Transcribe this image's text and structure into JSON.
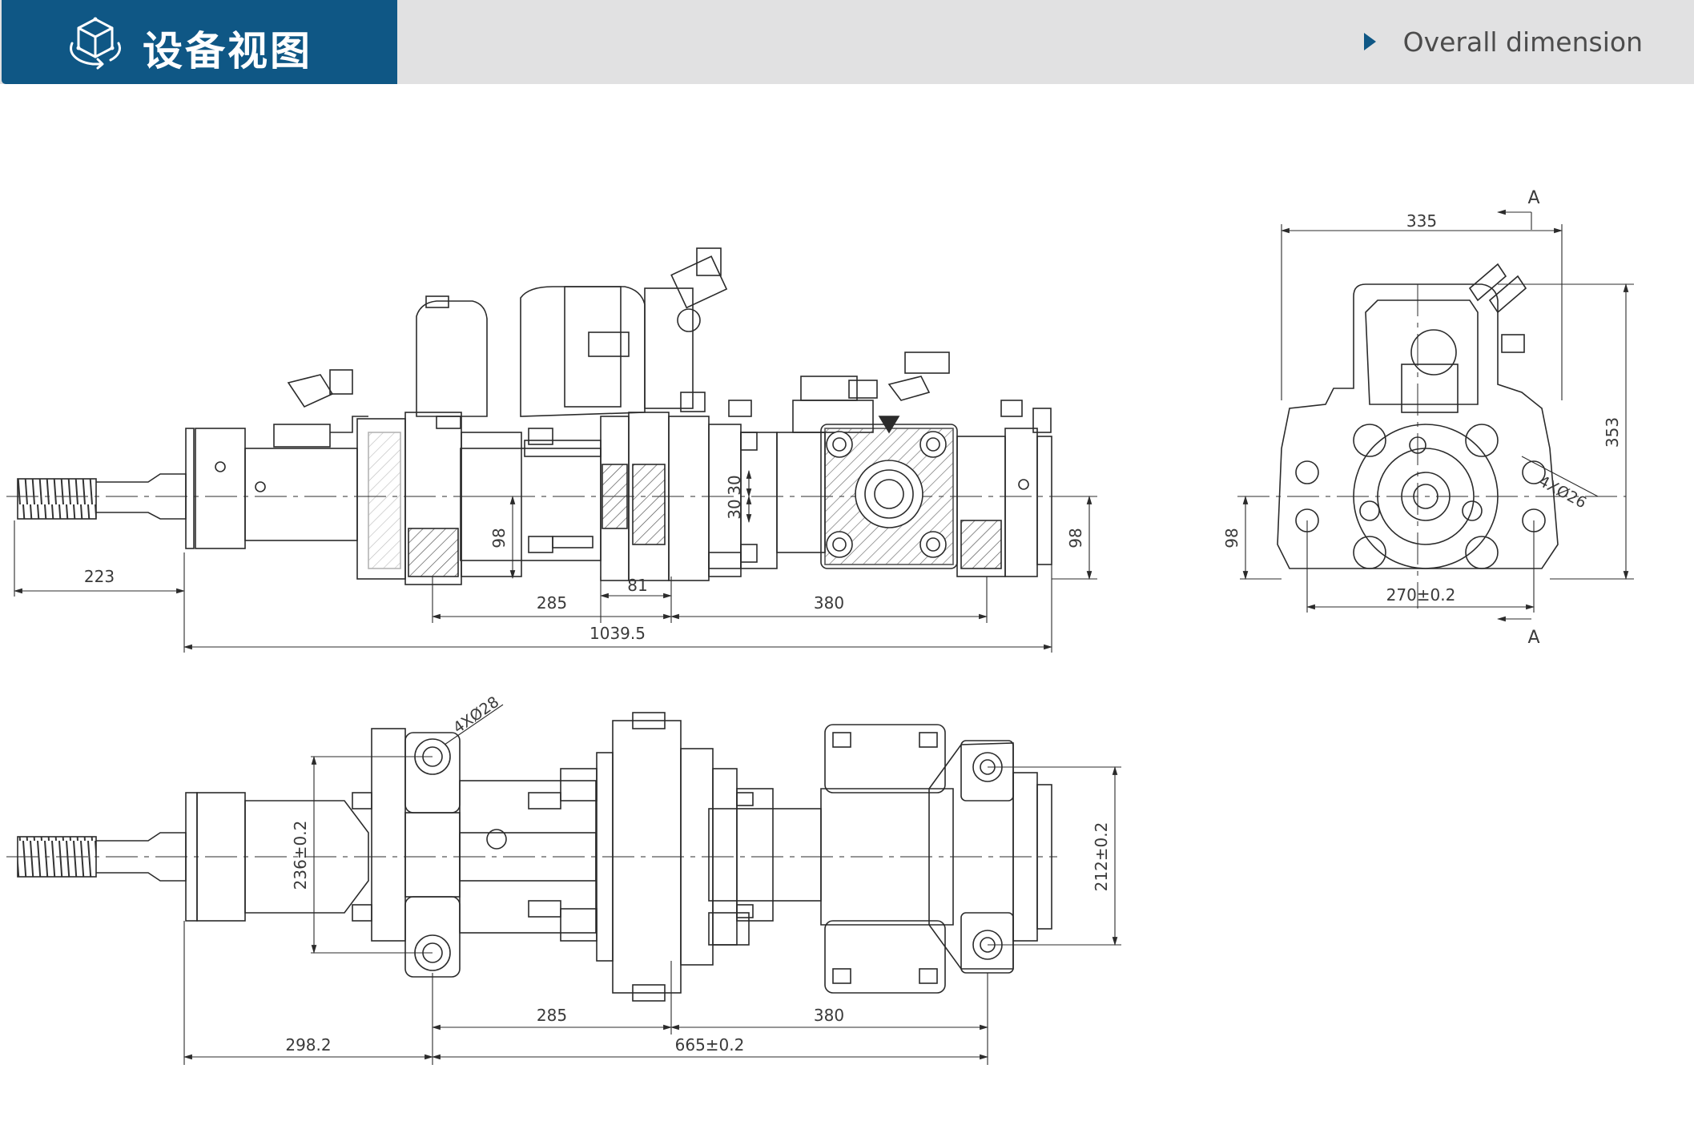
{
  "header": {
    "title": "设备视图",
    "section_link": "Overall dimension",
    "brand_color": "#0f5785",
    "bar_color": "#e1e1e2",
    "icon": "3d-cube-rotate-icon"
  },
  "drawing": {
    "front_view": {
      "dims": {
        "d223": "223",
        "d285": "285",
        "d81": "81",
        "d380": "380",
        "d1039": "1039.5",
        "d98a": "98",
        "d98b": "98",
        "d30a": "30",
        "d30b": "30"
      }
    },
    "side_view": {
      "dims": {
        "d335": "335",
        "d353": "353",
        "d98": "98",
        "d270": "270±0.2",
        "holes": "4XØ26",
        "sectionTop": "A",
        "sectionBottom": "A"
      }
    },
    "top_view": {
      "dims": {
        "holes": "4XØ28",
        "d236": "236±0.2",
        "d212": "212±0.2",
        "d285": "285",
        "d380": "380",
        "d298": "298.2",
        "d665": "665±0.2"
      }
    }
  }
}
